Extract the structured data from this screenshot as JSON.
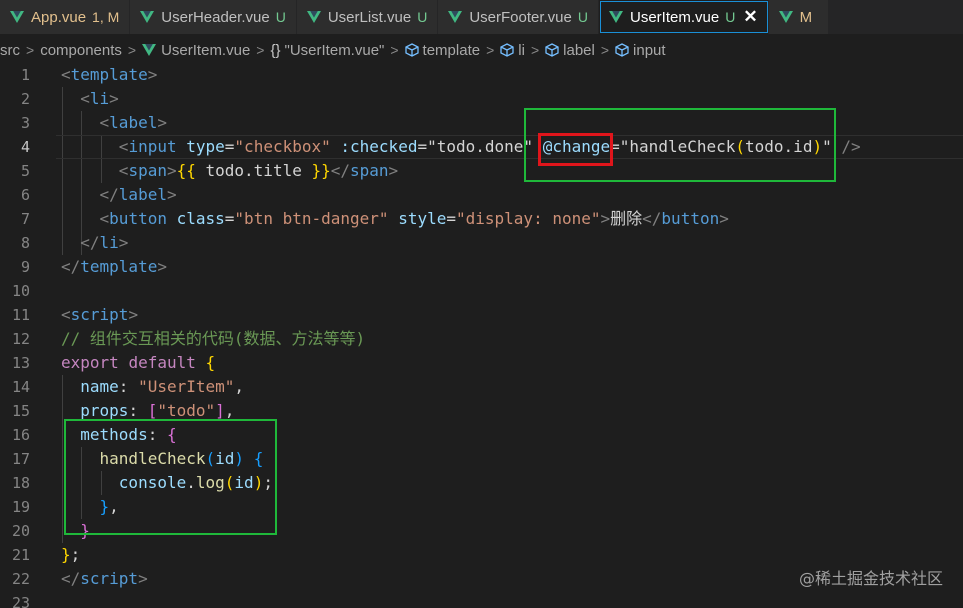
{
  "tabs": [
    {
      "name": "App.vue",
      "badge": "1, M",
      "modified": true,
      "active": false
    },
    {
      "name": "UserHeader.vue",
      "badge": "U",
      "modified": false,
      "active": false
    },
    {
      "name": "UserList.vue",
      "badge": "U",
      "modified": false,
      "active": false
    },
    {
      "name": "UserFooter.vue",
      "badge": "U",
      "modified": false,
      "active": false
    },
    {
      "name": "UserItem.vue",
      "badge": "U",
      "modified": false,
      "active": true,
      "close": "✕"
    },
    {
      "name": "M",
      "badge": "",
      "modified": true,
      "active": false
    }
  ],
  "breadcrumb": {
    "src": "src",
    "components": "components",
    "file": "UserItem.vue",
    "object": "\"UserItem.vue\"",
    "template": "template",
    "li": "li",
    "label": "label",
    "input": "input",
    "braces": "{}"
  },
  "editor": {
    "current_line": 4,
    "lines": [
      {
        "n": "1",
        "tokens": [
          [
            "t-punct",
            "<"
          ],
          [
            "t-tag",
            "template"
          ],
          [
            "t-punct",
            ">"
          ]
        ]
      },
      {
        "n": "2",
        "tokens": [
          [
            "t-plain",
            "  "
          ],
          [
            "t-punct",
            "<"
          ],
          [
            "t-tag",
            "li"
          ],
          [
            "t-punct",
            ">"
          ]
        ]
      },
      {
        "n": "3",
        "tokens": [
          [
            "t-plain",
            "    "
          ],
          [
            "t-punct",
            "<"
          ],
          [
            "t-tag",
            "label"
          ],
          [
            "t-punct",
            ">"
          ]
        ]
      },
      {
        "n": "4",
        "tokens": [
          [
            "t-plain",
            "      "
          ],
          [
            "t-punct",
            "<"
          ],
          [
            "t-tag",
            "input"
          ],
          [
            "t-plain",
            " "
          ],
          [
            "t-attr",
            "type"
          ],
          [
            "t-plain",
            "="
          ],
          [
            "t-str",
            "\"checkbox\""
          ],
          [
            "t-plain",
            " "
          ],
          [
            "t-attr",
            ":checked"
          ],
          [
            "t-plain",
            "="
          ],
          [
            "t-plain",
            "\"todo.done\""
          ],
          [
            "t-plain",
            " "
          ],
          [
            "t-attr",
            "@change"
          ],
          [
            "t-plain",
            "="
          ],
          [
            "t-plain",
            "\"handleCheck"
          ],
          [
            "t-br1",
            "("
          ],
          [
            "t-plain",
            "todo.id"
          ],
          [
            "t-br1",
            ")"
          ],
          [
            "t-plain",
            "\""
          ],
          [
            "t-plain",
            " "
          ],
          [
            "t-punct",
            "/>"
          ]
        ]
      },
      {
        "n": "5",
        "tokens": [
          [
            "t-plain",
            "      "
          ],
          [
            "t-punct",
            "<"
          ],
          [
            "t-tag",
            "span"
          ],
          [
            "t-punct",
            ">"
          ],
          [
            "t-br1",
            "{{"
          ],
          [
            "t-plain",
            " todo.title "
          ],
          [
            "t-br1",
            "}}"
          ],
          [
            "t-punct",
            "</"
          ],
          [
            "t-tag",
            "span"
          ],
          [
            "t-punct",
            ">"
          ]
        ]
      },
      {
        "n": "6",
        "tokens": [
          [
            "t-plain",
            "    "
          ],
          [
            "t-punct",
            "</"
          ],
          [
            "t-tag",
            "label"
          ],
          [
            "t-punct",
            ">"
          ]
        ]
      },
      {
        "n": "7",
        "tokens": [
          [
            "t-plain",
            "    "
          ],
          [
            "t-punct",
            "<"
          ],
          [
            "t-tag",
            "button"
          ],
          [
            "t-plain",
            " "
          ],
          [
            "t-attr",
            "class"
          ],
          [
            "t-plain",
            "="
          ],
          [
            "t-str",
            "\"btn btn-danger\""
          ],
          [
            "t-plain",
            " "
          ],
          [
            "t-attr",
            "style"
          ],
          [
            "t-plain",
            "="
          ],
          [
            "t-str",
            "\"display: none\""
          ],
          [
            "t-punct",
            ">"
          ],
          [
            "t-text",
            "删除"
          ],
          [
            "t-punct",
            "</"
          ],
          [
            "t-tag",
            "button"
          ],
          [
            "t-punct",
            ">"
          ]
        ]
      },
      {
        "n": "8",
        "tokens": [
          [
            "t-plain",
            "  "
          ],
          [
            "t-punct",
            "</"
          ],
          [
            "t-tag",
            "li"
          ],
          [
            "t-punct",
            ">"
          ]
        ]
      },
      {
        "n": "9",
        "tokens": [
          [
            "t-punct",
            "</"
          ],
          [
            "t-tag",
            "template"
          ],
          [
            "t-punct",
            ">"
          ]
        ]
      },
      {
        "n": "10",
        "tokens": []
      },
      {
        "n": "11",
        "tokens": [
          [
            "t-punct",
            "<"
          ],
          [
            "t-tag",
            "script"
          ],
          [
            "t-punct",
            ">"
          ]
        ]
      },
      {
        "n": "12",
        "tokens": [
          [
            "t-cmt",
            "// 组件交互相关的代码(数据、方法等等)"
          ]
        ]
      },
      {
        "n": "13",
        "tokens": [
          [
            "t-kw",
            "export"
          ],
          [
            "t-plain",
            " "
          ],
          [
            "t-kw",
            "default"
          ],
          [
            "t-plain",
            " "
          ],
          [
            "t-br1",
            "{"
          ]
        ]
      },
      {
        "n": "14",
        "tokens": [
          [
            "t-plain",
            "  "
          ],
          [
            "t-var",
            "name"
          ],
          [
            "t-plain",
            ": "
          ],
          [
            "t-str",
            "\"UserItem\""
          ],
          [
            "t-plain",
            ","
          ]
        ]
      },
      {
        "n": "15",
        "tokens": [
          [
            "t-plain",
            "  "
          ],
          [
            "t-var",
            "props"
          ],
          [
            "t-plain",
            ": "
          ],
          [
            "t-br2",
            "["
          ],
          [
            "t-str",
            "\"todo\""
          ],
          [
            "t-br2",
            "]"
          ],
          [
            "t-plain",
            ","
          ]
        ]
      },
      {
        "n": "16",
        "tokens": [
          [
            "t-plain",
            "  "
          ],
          [
            "t-var",
            "methods"
          ],
          [
            "t-plain",
            ": "
          ],
          [
            "t-br2",
            "{"
          ]
        ]
      },
      {
        "n": "17",
        "tokens": [
          [
            "t-plain",
            "    "
          ],
          [
            "t-fn",
            "handleCheck"
          ],
          [
            "t-br3",
            "("
          ],
          [
            "t-var",
            "id"
          ],
          [
            "t-br3",
            ")"
          ],
          [
            "t-plain",
            " "
          ],
          [
            "t-br3",
            "{"
          ]
        ]
      },
      {
        "n": "18",
        "tokens": [
          [
            "t-plain",
            "      "
          ],
          [
            "t-var",
            "console"
          ],
          [
            "t-plain",
            "."
          ],
          [
            "t-fn",
            "log"
          ],
          [
            "t-br1",
            "("
          ],
          [
            "t-var",
            "id"
          ],
          [
            "t-br1",
            ")"
          ],
          [
            "t-plain",
            ";"
          ]
        ]
      },
      {
        "n": "19",
        "tokens": [
          [
            "t-plain",
            "    "
          ],
          [
            "t-br3",
            "}"
          ],
          [
            "t-plain",
            ","
          ]
        ]
      },
      {
        "n": "20",
        "tokens": [
          [
            "t-plain",
            "  "
          ],
          [
            "t-br2",
            "}"
          ]
        ]
      },
      {
        "n": "21",
        "tokens": [
          [
            "t-br1",
            "}"
          ],
          [
            "t-plain",
            ";"
          ]
        ]
      },
      {
        "n": "22",
        "tokens": [
          [
            "t-punct",
            "</"
          ],
          [
            "t-tag",
            "script"
          ],
          [
            "t-punct",
            ">"
          ]
        ]
      },
      {
        "n": "23",
        "tokens": []
      }
    ]
  },
  "watermark": "@稀土掘金技术社区",
  "colors": {
    "green_box": "#1fb83a",
    "red_box": "#e0151b",
    "active_tab_border": "#1a8fd6",
    "background": "#1e1e1e"
  },
  "icons": {
    "vue_file": "vue-icon",
    "symbol": "cube-icon",
    "object": "braces-icon"
  }
}
